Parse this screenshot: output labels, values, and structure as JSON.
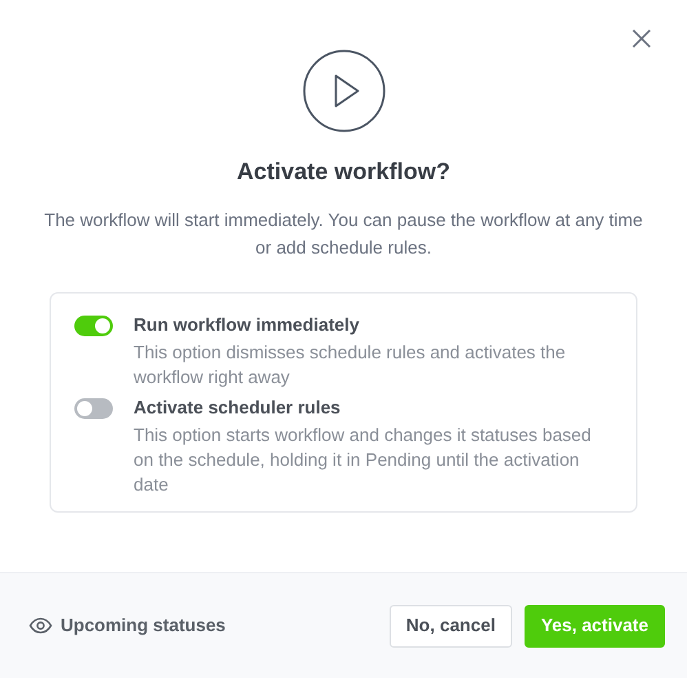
{
  "dialog": {
    "title": "Activate workflow?",
    "description": "The workflow will start immediately. You can pause the workflow at any time or add schedule rules."
  },
  "options": [
    {
      "title": "Run workflow immediately",
      "description": "This option dismisses schedule rules and activates the workflow right away",
      "on": true
    },
    {
      "title": "Activate scheduler rules",
      "description": "This option starts workflow and changes it statuses based on the schedule, holding it in Pending until the activation date",
      "on": false
    }
  ],
  "footer": {
    "link": "Upcoming statuses",
    "buttons": [
      {
        "label": "No, cancel",
        "kind": "secondary"
      },
      {
        "label": "Yes, activate",
        "kind": "primary"
      }
    ]
  }
}
